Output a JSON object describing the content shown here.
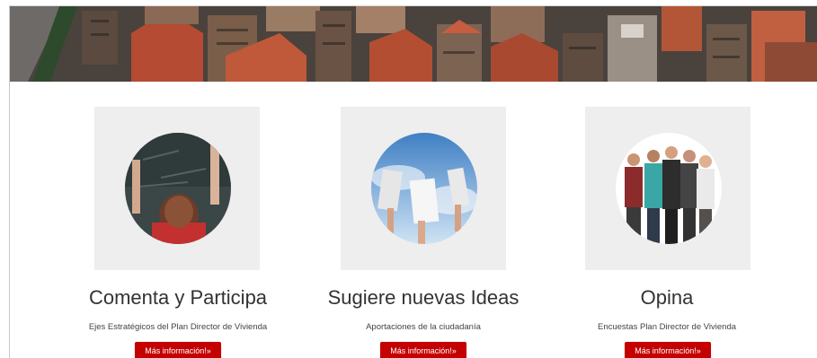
{
  "cards": [
    {
      "title": "Comenta y Participa",
      "subtitle": "Ejes Estratégicos del Plan Director de Vivienda",
      "button_label": "Más información!»",
      "image_icon": "classroom-raised-hands-photo"
    },
    {
      "title": "Sugiere nuevas Ideas",
      "subtitle": "Aportaciones de la ciudadanía",
      "button_label": "Más información!»",
      "image_icon": "hands-holding-papers-sky-photo"
    },
    {
      "title": "Opina",
      "subtitle": "Encuestas Plan Director de Vivienda",
      "button_label": "Más información!»",
      "image_icon": "group-of-people-photo"
    }
  ],
  "colors": {
    "accent": "#c40000",
    "image_bg": "#eeeeee",
    "title_text": "#333333"
  }
}
